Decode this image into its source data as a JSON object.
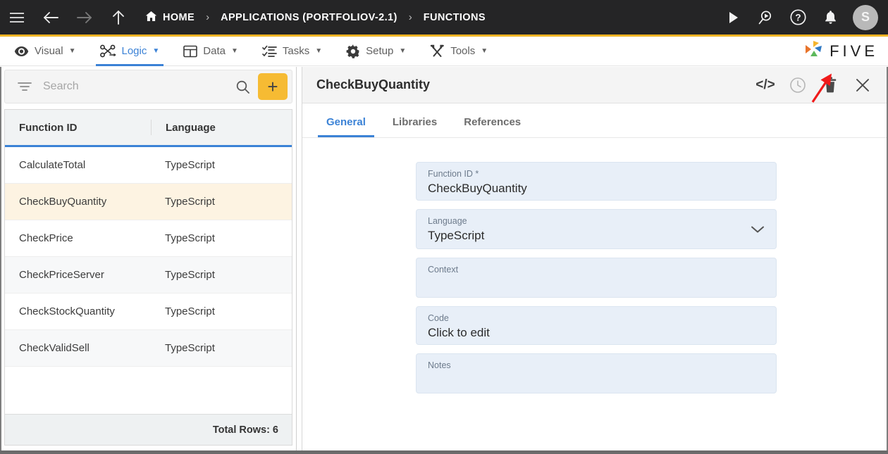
{
  "topbar": {
    "menu_icon": "hamburger-icon",
    "back_icon": "arrow-left-icon",
    "forward_icon": "arrow-right-icon",
    "up_icon": "arrow-up-icon",
    "breadcrumbs": [
      {
        "label": "HOME",
        "icon": "home-icon"
      },
      {
        "label": "APPLICATIONS (PORTFOLIOV-2.1)",
        "icon": ""
      },
      {
        "label": "FUNCTIONS",
        "icon": ""
      }
    ],
    "separator": "›",
    "actions": [
      {
        "name": "run-icon",
        "label": "Run"
      },
      {
        "name": "search-run-icon",
        "label": "Debug"
      },
      {
        "name": "help-icon",
        "label": "Help"
      },
      {
        "name": "notifications-icon",
        "label": "Notifications"
      }
    ],
    "avatar_initial": "S",
    "accent_underline": "#f0b323"
  },
  "menubar": {
    "items": [
      {
        "label": "Visual",
        "icon": "eye-icon",
        "active": false
      },
      {
        "label": "Logic",
        "icon": "graph-nodes-icon",
        "active": true
      },
      {
        "label": "Data",
        "icon": "table-grid-icon",
        "active": false
      },
      {
        "label": "Tasks",
        "icon": "checklist-icon",
        "active": false
      },
      {
        "label": "Setup",
        "icon": "gear-icon",
        "active": false
      },
      {
        "label": "Tools",
        "icon": "tools-icon",
        "active": false
      }
    ],
    "caret": "▼",
    "active_color": "#3b82d6",
    "logo_text": "FIVE"
  },
  "sidebar": {
    "search": {
      "placeholder": "Search",
      "value": "",
      "filter_icon": "filter-icon",
      "search_icon": "magnifier-icon"
    },
    "add_button_label": "+",
    "add_button_color": "#f6bb33",
    "columns": [
      "Function ID",
      "Language"
    ],
    "rows": [
      {
        "function_id": "CalculateTotal",
        "language": "TypeScript",
        "selected": false
      },
      {
        "function_id": "CheckBuyQuantity",
        "language": "TypeScript",
        "selected": true
      },
      {
        "function_id": "CheckPrice",
        "language": "TypeScript",
        "selected": false
      },
      {
        "function_id": "CheckPriceServer",
        "language": "TypeScript",
        "selected": false
      },
      {
        "function_id": "CheckStockQuantity",
        "language": "TypeScript",
        "selected": false
      },
      {
        "function_id": "CheckValidSell",
        "language": "TypeScript",
        "selected": false
      }
    ],
    "total_rows_label": "Total Rows: 6",
    "selected_row_color": "#fdf3e2"
  },
  "detail": {
    "title": "CheckBuyQuantity",
    "header_actions": [
      {
        "name": "code-view-icon",
        "label": "</>",
        "muted": false
      },
      {
        "name": "history-clock-icon",
        "label": "",
        "muted": true
      },
      {
        "name": "delete-trash-icon",
        "label": "",
        "muted": false
      },
      {
        "name": "close-icon",
        "label": "",
        "muted": false
      }
    ],
    "tabs": [
      {
        "label": "General",
        "active": true
      },
      {
        "label": "Libraries",
        "active": false
      },
      {
        "label": "References",
        "active": false
      }
    ],
    "fields": [
      {
        "label": "Function ID *",
        "value": "CheckBuyQuantity",
        "type": "text",
        "size": "h-small"
      },
      {
        "label": "Language",
        "value": "TypeScript",
        "type": "select",
        "size": "h-medium",
        "chevron": "chevron-down-icon"
      },
      {
        "label": "Context",
        "value": "",
        "type": "textarea",
        "size": "h-medium"
      },
      {
        "label": "Code",
        "value": "Click to edit",
        "type": "link",
        "size": "h-small"
      },
      {
        "label": "Notes",
        "value": "",
        "type": "textarea",
        "size": "h-medium"
      }
    ],
    "field_bg": "#e8eff8"
  },
  "annotation": {
    "arrow_color": "#f01a1a",
    "target": "delete-trash-icon"
  }
}
